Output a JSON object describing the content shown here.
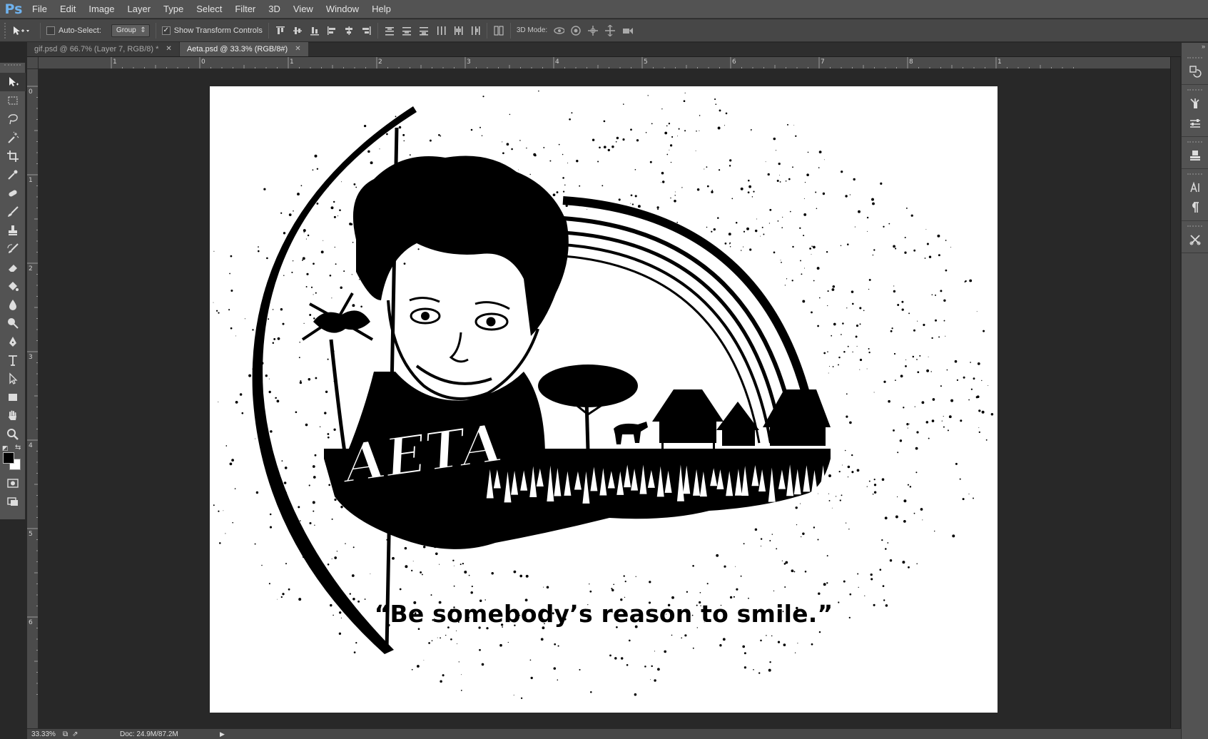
{
  "app": {
    "logo": "Ps"
  },
  "menu": [
    "File",
    "Edit",
    "Image",
    "Layer",
    "Type",
    "Select",
    "Filter",
    "3D",
    "View",
    "Window",
    "Help"
  ],
  "options": {
    "auto_select_label": "Auto-Select:",
    "auto_select_checked": false,
    "auto_select_value": "Group",
    "show_transform_label": "Show Transform Controls",
    "show_transform_checked": true,
    "mode3d_label": "3D Mode:"
  },
  "tabs": [
    {
      "label": "gif.psd @ 66.7% (Layer 7, RGB/8) *",
      "active": false
    },
    {
      "label": "Aeta.psd @ 33.3% (RGB/8#)",
      "active": true
    }
  ],
  "ruler": {
    "top_labels": [
      "1",
      "0",
      "1",
      "2",
      "3",
      "4",
      "5",
      "6",
      "7",
      "8",
      "1"
    ],
    "left_labels": [
      "0",
      "1",
      "2",
      "3",
      "4",
      "5",
      "6"
    ]
  },
  "artwork": {
    "banner_text": "AETA",
    "quote": "“Be somebody’s reason to smile.”",
    "ink_color": "#000000",
    "paper_color": "#ffffff"
  },
  "status": {
    "zoom": "33.33%",
    "doc_size": "Doc: 24.9M/87.2M"
  },
  "tools": [
    "move-icon",
    "marquee-icon",
    "lasso-icon",
    "magic-wand-icon",
    "crop-icon",
    "eyedropper-icon",
    "healing-brush-icon",
    "brush-icon",
    "clone-stamp-icon",
    "history-brush-icon",
    "eraser-icon",
    "paint-bucket-icon",
    "blur-icon",
    "dodge-icon",
    "pen-icon",
    "type-icon",
    "path-selection-icon",
    "rectangle-icon",
    "hand-icon",
    "zoom-icon",
    "quick-mask-icon",
    "screen-mode-icon"
  ],
  "right_panels": [
    "history-icon",
    "brush-panel-icon",
    "adjustments-icon",
    "layers-icon",
    "character-icon",
    "paragraph-icon",
    "tools-preset-icon"
  ]
}
